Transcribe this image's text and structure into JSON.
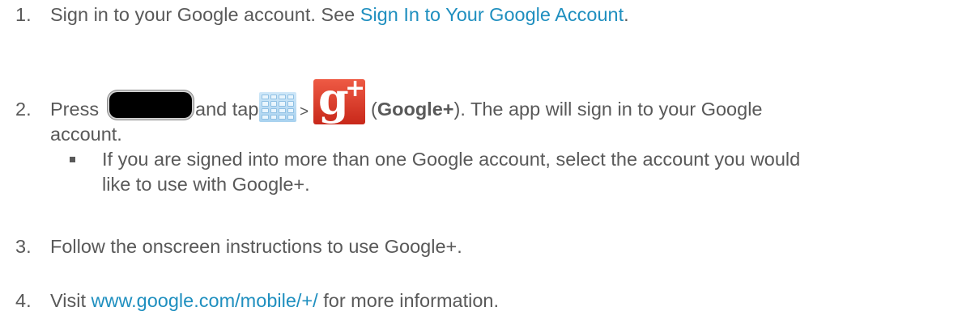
{
  "steps": [
    {
      "number": "1.",
      "prefix": "Sign in to your Google account. See ",
      "link": "Sign In to Your Google Account",
      "suffix": "."
    },
    {
      "number": "2.",
      "press": "Press",
      "and_tap": "and tap",
      "gt": ">",
      "paren_open": "(",
      "bold": "Google+",
      "after_bold": "). The app will sign in to your Google",
      "line2": "account."
    },
    {
      "number": "3.",
      "text": "Follow the onscreen instructions to use Google+."
    },
    {
      "number": "4.",
      "prefix": "Visit ",
      "link": "www.google.com/mobile/+/",
      "suffix": " for more information."
    }
  ],
  "sub_bullet": {
    "line1": "If you are signed into more than one Google account, select the account you would",
    "line2": "like to use with Google+."
  },
  "icons": {
    "home_key": "home-key-icon",
    "apps": "apps-grid-icon",
    "google_plus": "google-plus-icon",
    "google_plus_glyphs": {
      "g": "g",
      "plus": "+"
    }
  },
  "colors": {
    "text": "#595959",
    "link": "#1f8fbf",
    "google_plus_red": "#dd4b39"
  }
}
